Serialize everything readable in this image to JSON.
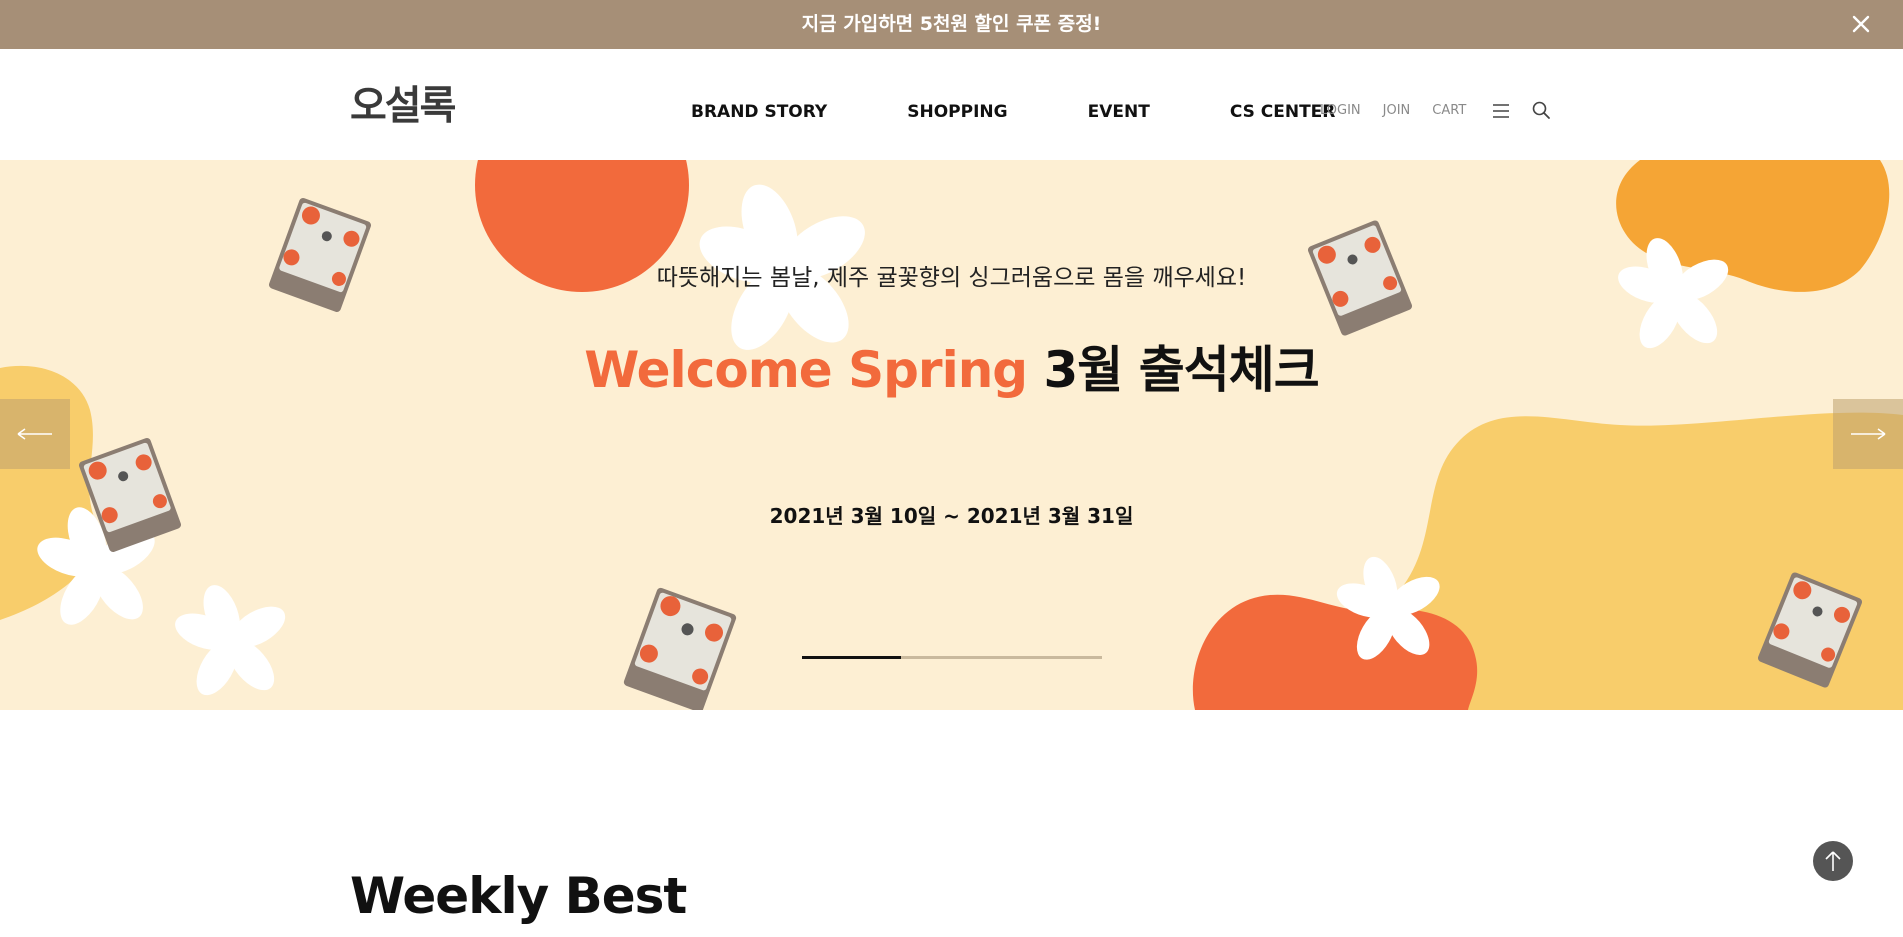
{
  "promo": {
    "message": "지금 가입하면 5천원 할인 쿠폰 증정!",
    "close_icon": "close-icon"
  },
  "header": {
    "logo": "오설록",
    "nav": [
      "BRAND STORY",
      "SHOPPING",
      "EVENT",
      "CS CENTER"
    ],
    "util": [
      "LOGIN",
      "JOIN",
      "CART"
    ],
    "menu_icon": "hamburger-menu-icon",
    "search_icon": "search-icon"
  },
  "hero": {
    "subtitle": "따뜻해지는 봄날, 제주 귤꽃향의 싱그러움으로 몸을 깨우세요!",
    "title_accent": "Welcome Spring",
    "title_rest": "3월 출석체크",
    "date": "2021년 3월 10일 ~ 2021년 3월 31일",
    "slide_progress": 0.33,
    "prev_icon": "arrow-left-icon",
    "next_icon": "arrow-right-icon"
  },
  "weekly": {
    "title": "Weekly Best"
  },
  "top_button": {
    "icon": "arrow-up-icon"
  },
  "colors": {
    "promo_bg": "#a68f77",
    "hero_bg": "#fdefd3",
    "accent_orange": "#f26a3c",
    "tangerine": "#f5a535",
    "yellow_blob": "#f8cd6b"
  }
}
